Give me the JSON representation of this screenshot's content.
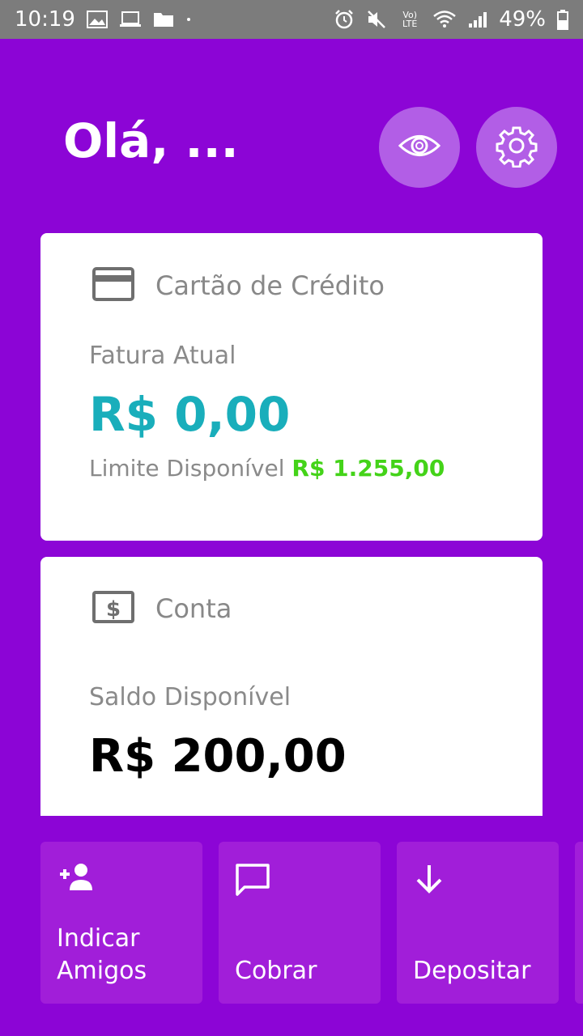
{
  "status_bar": {
    "time": "10:19",
    "battery": "49%",
    "network_label": "Vo) LTE",
    "icons_left": [
      "image-icon",
      "laptop-icon",
      "folder-icon",
      "dot-icon"
    ],
    "icons_right": [
      "alarm-icon",
      "mute-icon",
      "volte-icon",
      "wifi-icon",
      "signal-icon",
      "battery-icon"
    ]
  },
  "header": {
    "greeting": "Olá, ...",
    "buttons": [
      "eye-icon",
      "gear-icon"
    ]
  },
  "credit_card": {
    "title": "Cartão de Crédito",
    "invoice_label": "Fatura Atual",
    "invoice_value": "R$ 0,00",
    "limit_label": "Limite Disponível",
    "limit_value": "R$ 1.255,00"
  },
  "account": {
    "title": "Conta",
    "balance_label": "Saldo Disponível",
    "balance_value": "R$ 200,00"
  },
  "actions": [
    {
      "label_line1": "Indicar",
      "label_line2": "Amigos",
      "icon": "person-add-icon"
    },
    {
      "label_line1": "",
      "label_line2": "Cobrar",
      "icon": "message-icon"
    },
    {
      "label_line1": "",
      "label_line2": "Depositar",
      "icon": "arrow-down-icon"
    }
  ],
  "colors": {
    "background": "#8c05d6",
    "card": "#ffffff",
    "teal": "#19aebb",
    "green": "#44d319",
    "action_bg": "#a11ed9",
    "round_btn": "#b25ee6"
  }
}
